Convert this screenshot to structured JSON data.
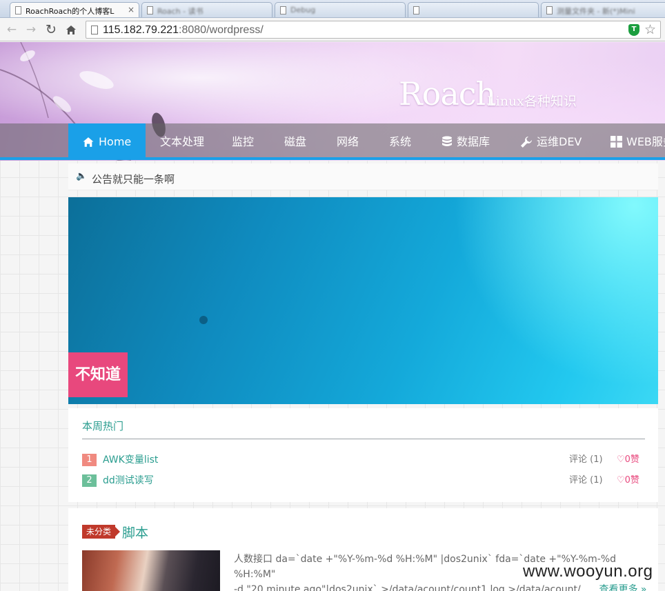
{
  "browser": {
    "tabs": [
      {
        "title": "RoachRoach的个人博客L",
        "close": "×"
      },
      {
        "title": "Roach - 读书"
      },
      {
        "title": "Debug"
      },
      {
        "title": ""
      },
      {
        "title": "测量文件夹 - 新(*)Mini"
      }
    ],
    "url_host": "115.182.79.221",
    "url_rest": ":8080/wordpress/",
    "icons": {
      "back": "arrow-left-icon",
      "forward": "arrow-right-icon",
      "reload": "reload-icon",
      "home": "home-icon"
    }
  },
  "site": {
    "title": "Roach",
    "subtitle": "Linux各种知识"
  },
  "nav": {
    "items": [
      {
        "label": "Home",
        "icon": "home-icon"
      },
      {
        "label": "文本处理"
      },
      {
        "label": "监控"
      },
      {
        "label": "磁盘"
      },
      {
        "label": "网络"
      },
      {
        "label": "系统"
      },
      {
        "label": "数据库",
        "icon": "database-icon"
      },
      {
        "label": "运维DEV",
        "icon": "wrench-icon"
      },
      {
        "label": "WEB服务",
        "icon": "grid-icon"
      }
    ],
    "active_color": "#1aa0e8"
  },
  "notice": {
    "text": "公告就只能一条啊"
  },
  "slider": {
    "caption": "不知道"
  },
  "hot": {
    "title": "本周热门",
    "items": [
      {
        "rank": "1",
        "title": "AWK变量list",
        "comments": "评论 (1)",
        "likes": "0赞",
        "rank_color": "#f08a80"
      },
      {
        "rank": "2",
        "title": "dd测试读写",
        "comments": "评论 (1)",
        "likes": "0赞",
        "rank_color": "#6cbf9a"
      }
    ]
  },
  "post": {
    "category": "未分类",
    "title": "脚本",
    "excerpt_line1": "人数接口 da=`date +\"%Y-%m-%d %H:%M\" |dos2unix` fda=`date +\"%Y-%m-%d %H:%M\"",
    "excerpt_line2": "-d \"20 minute ago\"|dos2unix` >/data/acount/count1.log >/data/acount/......",
    "more": "查看更多 »"
  },
  "watermark": "www.wooyun.org"
}
